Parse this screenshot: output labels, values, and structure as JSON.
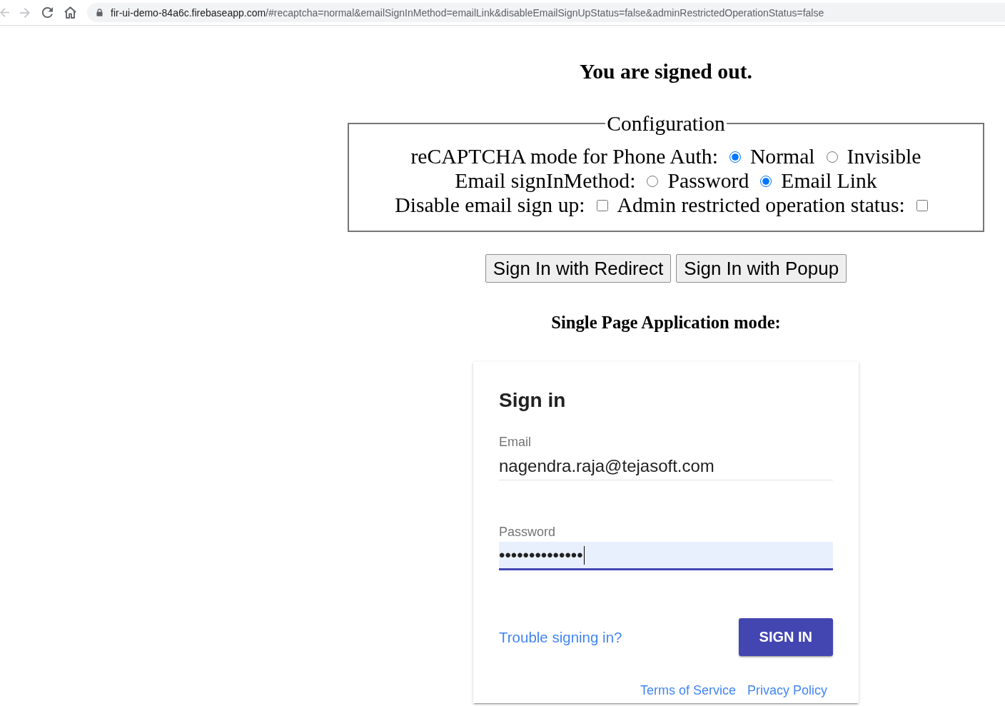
{
  "browser": {
    "nav_buttons": [
      {
        "kind": "back",
        "disabled": true
      },
      {
        "kind": "forward",
        "disabled": true
      },
      {
        "kind": "reload",
        "disabled": false
      },
      {
        "kind": "home",
        "disabled": false
      }
    ],
    "url": {
      "host": "fir-ui-demo-84a6c.firebaseapp.com",
      "path": "/#recaptcha=normal&emailSignInMethod=emailLink&disableEmailSignUpStatus=false&adminRestrictedOperationStatus=false"
    }
  },
  "heading": "You are signed out.",
  "configuration": {
    "legend": "Configuration",
    "rows": [
      {
        "items": [
          {
            "kind": "text",
            "text": "reCAPTCHA mode for Phone Auth:"
          },
          {
            "kind": "radio",
            "label": "Normal",
            "selected": true
          },
          {
            "kind": "radio",
            "label": "Invisible",
            "selected": false
          }
        ]
      },
      {
        "items": [
          {
            "kind": "text",
            "text": "Email signInMethod:"
          },
          {
            "kind": "radio",
            "label": "Password",
            "selected": false
          },
          {
            "kind": "radio",
            "label": "Email Link",
            "selected": true
          }
        ]
      },
      {
        "items": [
          {
            "kind": "text",
            "text": "Disable email sign up:"
          },
          {
            "kind": "checkbox",
            "checked": false
          },
          {
            "kind": "text",
            "text": "Admin restricted operation status:"
          },
          {
            "kind": "checkbox",
            "checked": false
          }
        ]
      }
    ]
  },
  "buttons": [
    "Sign In with Redirect",
    "Sign In with Popup"
  ],
  "spa_heading": "Single Page Application mode:",
  "sign_in_card": {
    "title": "Sign in",
    "fields": [
      {
        "label": "Email",
        "value": "nagendra.raja@tejasoft.com",
        "focused": false,
        "autofilled": false
      },
      {
        "label": "Password",
        "value": "••••••••••••••",
        "focused": true,
        "autofilled": true
      }
    ],
    "help_link": "Trouble signing in?",
    "submit_button": "SIGN IN",
    "footer_links": [
      "Terms of Service",
      "Privacy Policy"
    ]
  }
}
